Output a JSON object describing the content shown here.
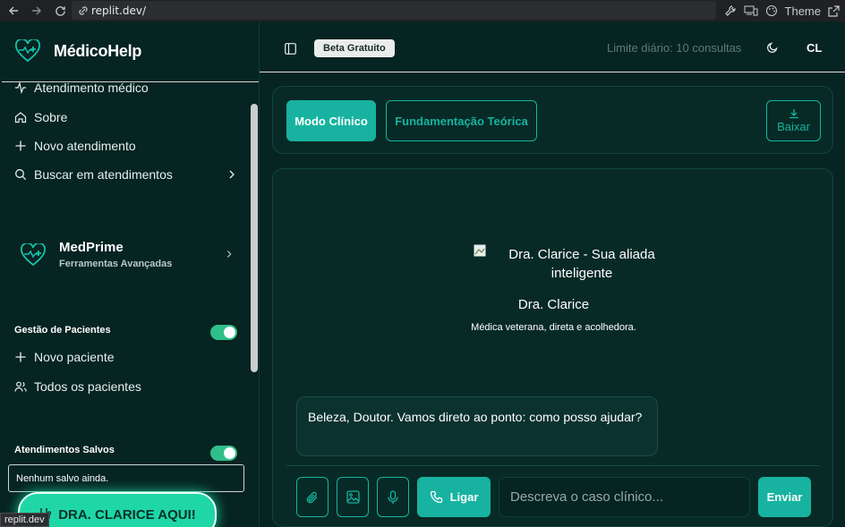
{
  "browser": {
    "url": "replit.dev/",
    "theme_label": "Theme",
    "status_url": "replit.dev"
  },
  "sidebar": {
    "brand": {
      "name_part1": "Médico",
      "name_part2": "Help"
    },
    "items": [
      {
        "label": "Atendimento médico",
        "icon": "activity-icon"
      },
      {
        "label": "Sobre",
        "icon": "home-icon"
      },
      {
        "label": "Novo atendimento",
        "icon": "plus-icon"
      },
      {
        "label": "Buscar em atendimentos",
        "icon": "search-icon"
      }
    ],
    "medprime": {
      "title": "MedPrime",
      "subtitle": "Ferramentas Avançadas"
    },
    "patients": {
      "section_label": "Gestão de Pacientes",
      "items": [
        {
          "label": "Novo paciente",
          "icon": "plus-icon"
        },
        {
          "label": "Todos os pacientes",
          "icon": "users-icon"
        }
      ]
    },
    "saved": {
      "section_label": "Atendimentos Salvos",
      "empty_text": "Nenhum salvo ainda."
    },
    "cta_label": "DRA. CLARICE AQUI!"
  },
  "header": {
    "beta_badge": "Beta Gratuito",
    "limit_text": "Limite diário: 10 consultas",
    "avatar_initials": "CL"
  },
  "modes": {
    "clinical": "Modo Clínico",
    "theory": "Fundamentação Teórica",
    "download": "Baixar"
  },
  "chat": {
    "agent_img_alt": "Dra. Clarice - Sua aliada inteligente",
    "agent_name": "Dra. Clarice",
    "agent_description": "Médica veterana, direta e acolhedora.",
    "messages": [
      {
        "text": "Beleza, Doutor. Vamos direto ao ponto: como posso ajudar?"
      }
    ],
    "call_label": "Ligar",
    "input_placeholder": "Descreva o caso clínico...",
    "send_label": "Enviar"
  },
  "colors": {
    "background": "#062421",
    "accent": "#17b3a0",
    "toggle_on": "#2fbf8a",
    "cta": "#1fd6a6"
  }
}
